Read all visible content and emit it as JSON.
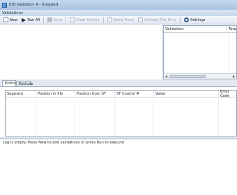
{
  "window": {
    "title": "EDI Validator 4 - Stopped"
  },
  "menu": {
    "items": [
      {
        "label": "Validations"
      }
    ]
  },
  "toolbar": {
    "new_label": "New",
    "run_all_label": "Run All",
    "stop_label": "Stop",
    "clear_history_label": "Clear History",
    "show_trace_label": "Show Trace",
    "exclude_error_label": "Exclude The Error",
    "settings_label": "Settings"
  },
  "validation_panel": {
    "col_validation": "Validation",
    "col_total": "Tota"
  },
  "tabs": {
    "errors": "Errors",
    "exclude": "Exclude"
  },
  "errors_grid": {
    "columns": [
      "Segment",
      "Position in file",
      "Position from ST",
      "ST Control #",
      "Value",
      "Error Code"
    ]
  },
  "log": {
    "text": "Log is empty. Press New to add validations or press Run to execute"
  }
}
